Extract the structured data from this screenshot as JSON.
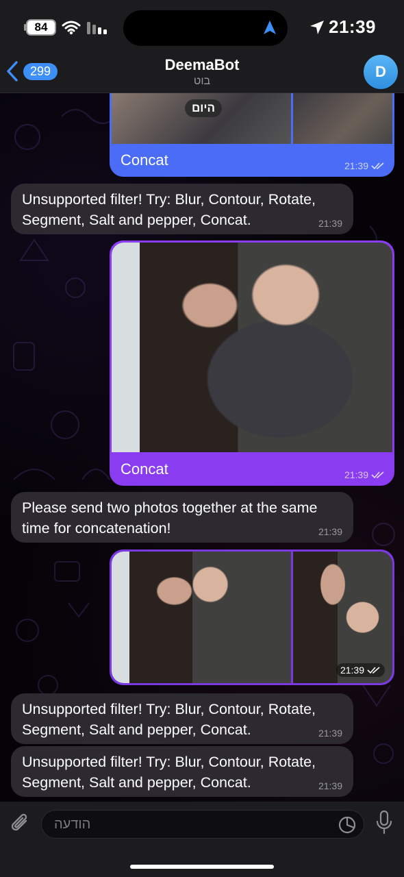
{
  "status_bar": {
    "battery": "84",
    "time": "21:39"
  },
  "header": {
    "back_count": "299",
    "title": "DeemaBot",
    "subtitle": "בוט",
    "avatar_letter": "D"
  },
  "date_chip": "היום",
  "messages": [
    {
      "direction": "out",
      "type": "photos-caption",
      "caption": "Concat",
      "time": "21:39",
      "bubble_color": "#4a6cf7"
    },
    {
      "direction": "in",
      "text": "Unsupported filter! Try: Blur, Contour, Rotate, Segment, Salt and pepper, Concat.",
      "time": "21:39"
    },
    {
      "direction": "out",
      "type": "photo-caption",
      "caption": "Concat",
      "time": "21:39",
      "bubble_color": "#8a3cf0"
    },
    {
      "direction": "in",
      "text": "Please send two photos together at the same time for concatenation!",
      "time": "21:39"
    },
    {
      "direction": "out",
      "type": "photos",
      "time": "21:39",
      "bubble_color": "#7a3ae0"
    },
    {
      "direction": "in",
      "text": "Unsupported filter! Try: Blur, Contour, Rotate, Segment, Salt and pepper, Concat.",
      "time": "21:39"
    },
    {
      "direction": "in",
      "text": "Unsupported filter! Try: Blur, Contour, Rotate, Segment, Salt and pepper, Concat.",
      "time": "21:39"
    }
  ],
  "input": {
    "placeholder": "הודעה"
  },
  "icons": [
    "battery-icon",
    "wifi-icon",
    "signal-icon",
    "navigation-icon",
    "location-arrow-icon",
    "back-chevron-icon",
    "double-check-icon",
    "attach-icon",
    "sticker-icon",
    "mic-icon"
  ]
}
